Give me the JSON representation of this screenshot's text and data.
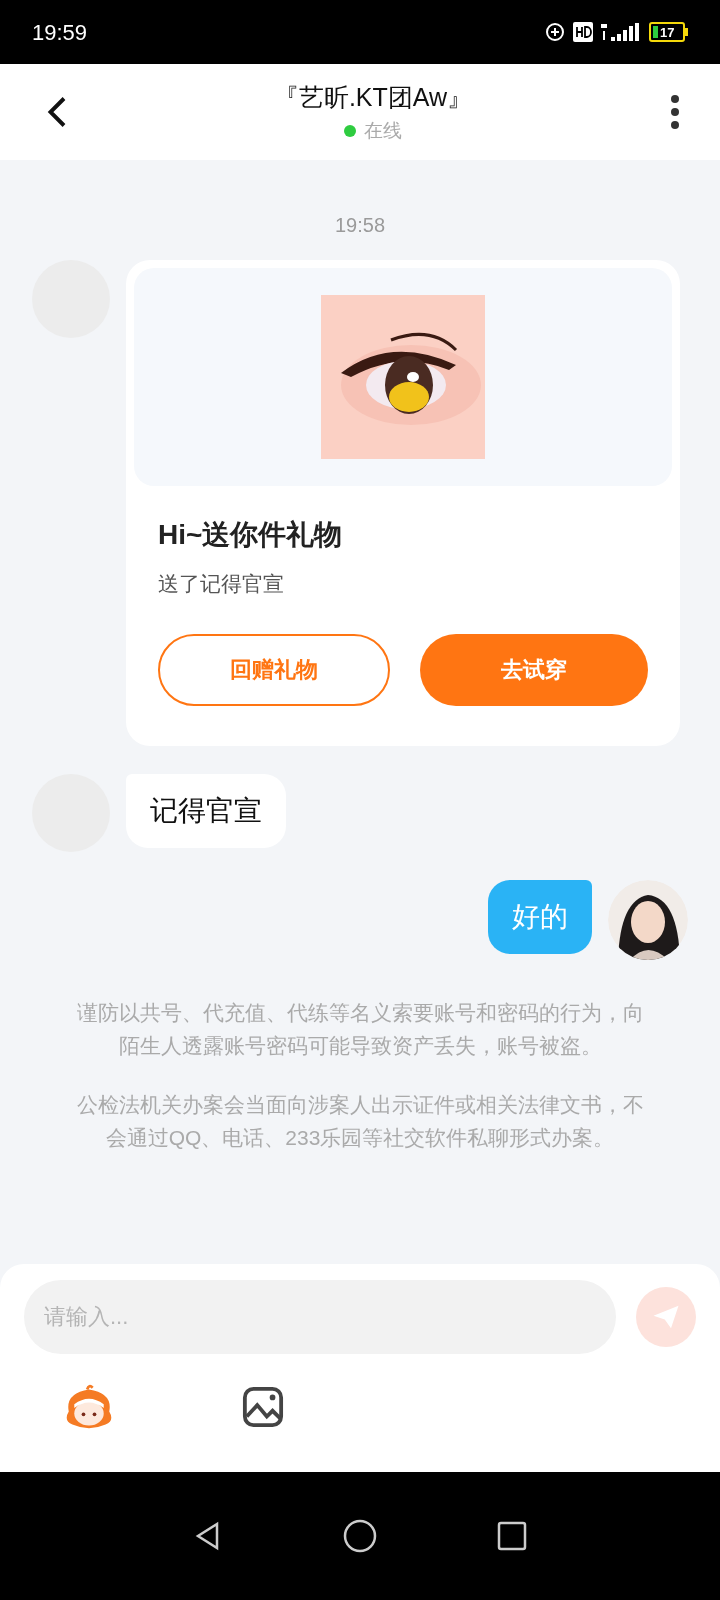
{
  "status_bar": {
    "time": "19:59",
    "battery": "17"
  },
  "header": {
    "title": "『艺昕.KT团Aw』",
    "status": "在线",
    "online": true
  },
  "messages": [
    {
      "kind": "time",
      "text": "19:58"
    },
    {
      "kind": "gift_card",
      "title": "Hi~送你件礼物",
      "subtitle": "送了记得官宣",
      "buttons": [
        {
          "label": "回赠礼物",
          "primary": false
        },
        {
          "label": "去试穿",
          "primary": true
        }
      ]
    },
    {
      "kind": "text",
      "outgoing": false,
      "text": "记得官宣"
    },
    {
      "kind": "text",
      "outgoing": true,
      "text": "好的"
    }
  ],
  "notices": [
    "谨防以共号、代充值、代练等名义索要账号和密码的行为，向陌生人透露账号密码可能导致资产丢失，账号被盗。",
    "公检法机关办案会当面向涉案人出示证件或相关法律文书，不会通过QQ、电话、233乐园等社交软件私聊形式办案。"
  ],
  "composer": {
    "placeholder": "请输入...",
    "send_disabled": true
  }
}
